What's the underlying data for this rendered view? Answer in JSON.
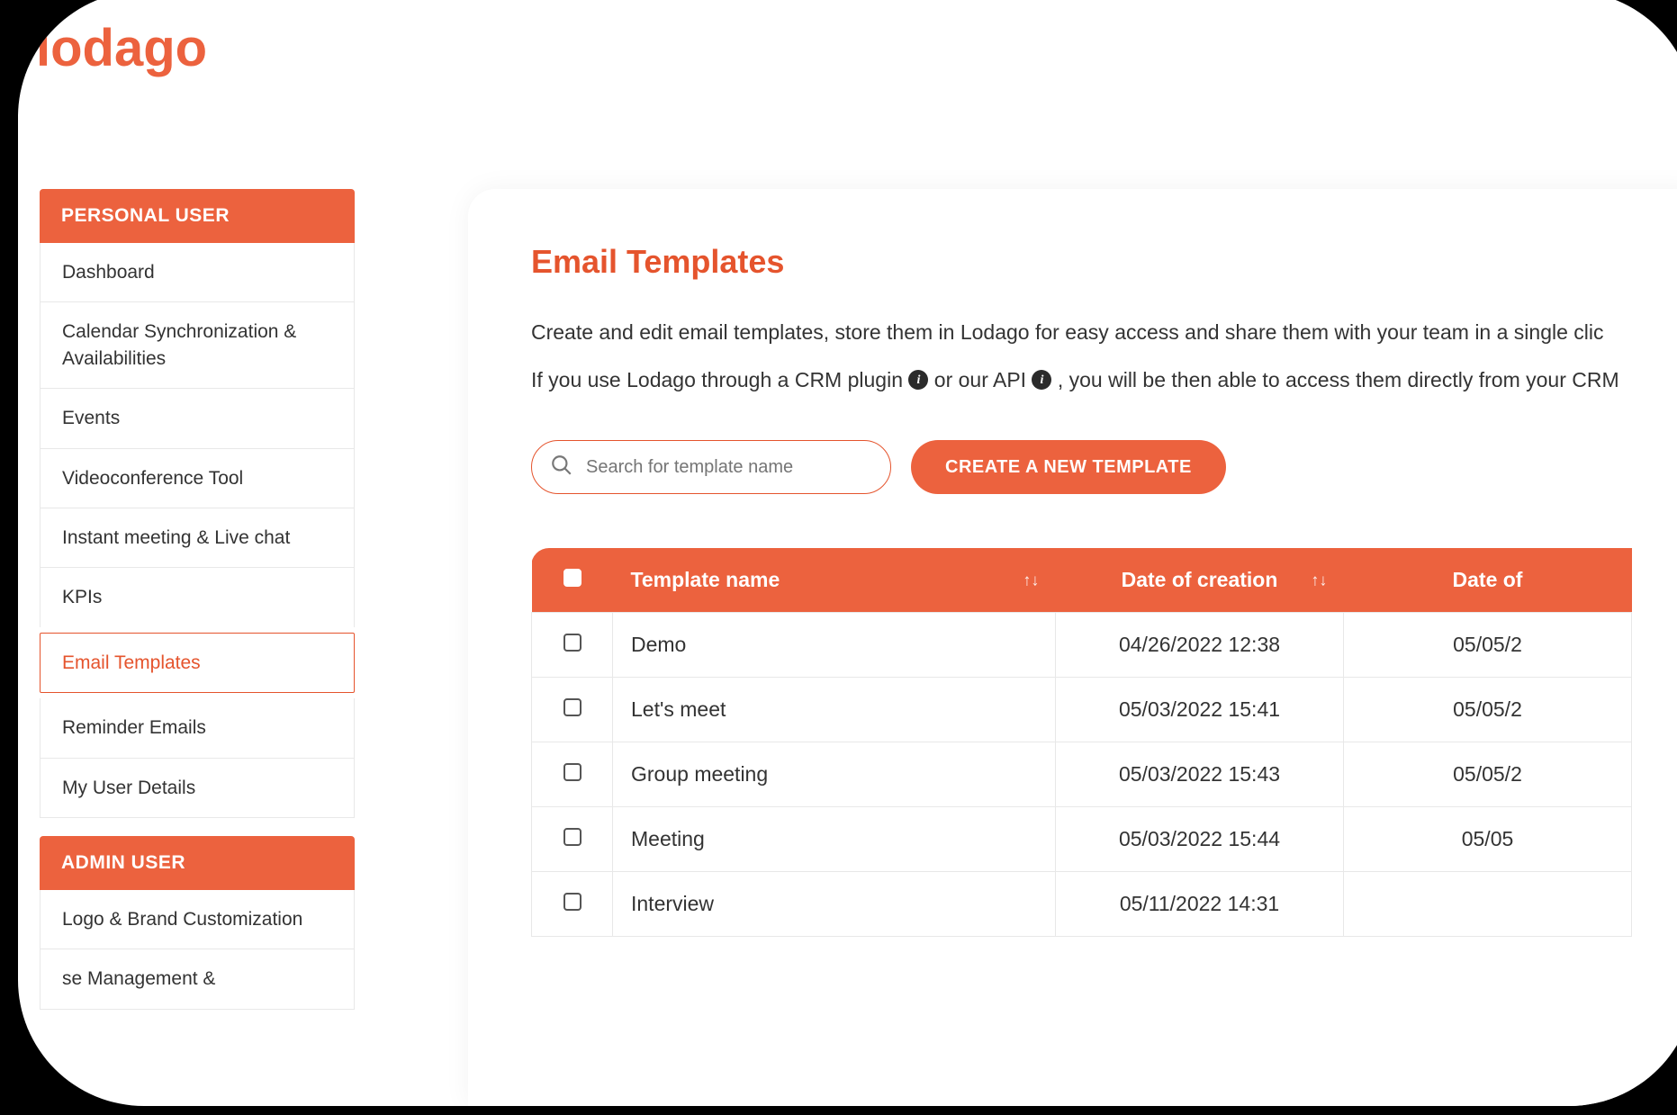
{
  "brand": {
    "name": "lodago"
  },
  "sidebar": {
    "sections": [
      {
        "header": "PERSONAL USER",
        "items": [
          {
            "label": "Dashboard",
            "active": false
          },
          {
            "label": "Calendar Synchronization & Availabilities",
            "active": false
          },
          {
            "label": "Events",
            "active": false
          },
          {
            "label": "Videoconference Tool",
            "active": false
          },
          {
            "label": "Instant meeting & Live chat",
            "active": false
          },
          {
            "label": "KPIs",
            "active": false
          },
          {
            "label": "Email Templates",
            "active": true
          },
          {
            "label": "Reminder Emails",
            "active": false
          },
          {
            "label": "My User Details",
            "active": false
          }
        ]
      },
      {
        "header": "ADMIN USER",
        "items": [
          {
            "label": "Logo & Brand Customization",
            "active": false
          },
          {
            "label": "se Management &",
            "active": false
          }
        ]
      }
    ]
  },
  "main": {
    "title": "Email Templates",
    "desc1": "Create and edit email templates, store them in Lodago for easy access and share them with your team in a single clic",
    "desc2_a": "If you use Lodago through a CRM plugin ",
    "desc2_b": " or our API ",
    "desc2_c": ", you will be then able to access them directly from your CRM",
    "search_placeholder": "Search for template name",
    "create_button": "CREATE A NEW TEMPLATE",
    "table": {
      "columns": [
        "",
        "Template name",
        "Date of creation",
        "Date of"
      ],
      "rows": [
        {
          "name": "Demo",
          "created": "04/26/2022 12:38",
          "updated": "05/05/2"
        },
        {
          "name": "Let's meet",
          "created": "05/03/2022 15:41",
          "updated": "05/05/2"
        },
        {
          "name": "Group meeting",
          "created": "05/03/2022 15:43",
          "updated": "05/05/2"
        },
        {
          "name": "Meeting",
          "created": "05/03/2022 15:44",
          "updated": "05/05"
        },
        {
          "name": "Interview",
          "created": "05/11/2022 14:31",
          "updated": ""
        }
      ]
    }
  }
}
